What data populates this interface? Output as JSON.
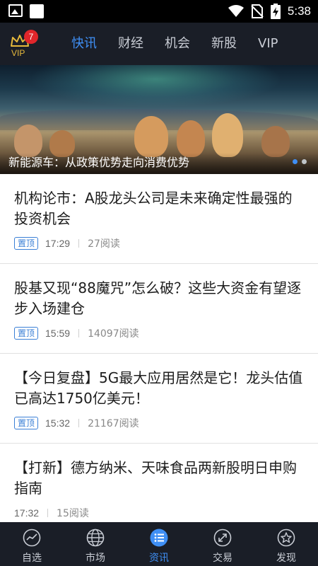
{
  "status_bar": {
    "time": "5:38",
    "icons": [
      "image-icon",
      "square-icon",
      "wifi-icon",
      "no-sim-icon",
      "battery-charging-icon"
    ]
  },
  "top_nav": {
    "vip_label": "VIP",
    "vip_badge_count": "7",
    "tabs": [
      {
        "label": "快讯",
        "active": true
      },
      {
        "label": "财经",
        "active": false
      },
      {
        "label": "机会",
        "active": false
      },
      {
        "label": "新股",
        "active": false
      },
      {
        "label": "VIP",
        "active": false
      }
    ]
  },
  "banner": {
    "caption": "新能源车：从政策优势走向消费优势",
    "slide_count": 2,
    "active_slide": 1
  },
  "articles": [
    {
      "title": "机构论市：A股龙头公司是未来确定性最强的投资机会",
      "tag": "置顶",
      "time": "17:29",
      "reads": "27阅读"
    },
    {
      "title": "股基又现“88魔咒”怎么破？这些大资金有望逐步入场建仓",
      "tag": "置顶",
      "time": "15:59",
      "reads": "14097阅读"
    },
    {
      "title": "【今日复盘】5G最大应用居然是它！龙头估值已高达1750亿美元！",
      "tag": "置顶",
      "time": "15:32",
      "reads": "21167阅读"
    },
    {
      "title": "【打新】德方纳米、天味食品两新股明日申购指南",
      "tag": "",
      "time": "17:32",
      "reads": "15阅读"
    }
  ],
  "bottom_tabs": [
    {
      "label": "自选",
      "icon": "trend-icon",
      "active": false
    },
    {
      "label": "市场",
      "icon": "globe-icon",
      "active": false
    },
    {
      "label": "资讯",
      "icon": "news-list-icon",
      "active": true
    },
    {
      "label": "交易",
      "icon": "exchange-icon",
      "active": false
    },
    {
      "label": "发现",
      "icon": "star-icon",
      "active": false
    }
  ],
  "colors": {
    "nav_bg": "#1a1e27",
    "accent": "#3f8ff5",
    "badge": "#e0262b",
    "vip_gold": "#e6b93c"
  }
}
